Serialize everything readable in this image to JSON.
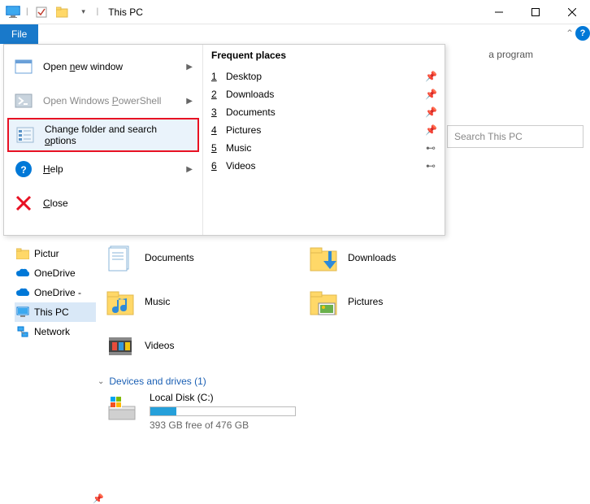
{
  "window": {
    "title": "This PC"
  },
  "tabs": {
    "file": "File"
  },
  "ribbon_peek": "a program",
  "file_menu": {
    "items": [
      {
        "prefix": "Open ",
        "u": "n",
        "rest": "ew window",
        "dim": false,
        "arrow": true,
        "highlight": false
      },
      {
        "prefix": "Open Windows ",
        "u": "P",
        "rest": "owerShell",
        "dim": true,
        "arrow": true,
        "highlight": false
      },
      {
        "prefix": "Change folder and search ",
        "u": "o",
        "rest": "ptions",
        "dim": false,
        "arrow": false,
        "highlight": true
      },
      {
        "prefix": "",
        "u": "H",
        "rest": "elp",
        "dim": false,
        "arrow": true,
        "highlight": false
      },
      {
        "prefix": "",
        "u": "C",
        "rest": "lose",
        "dim": false,
        "arrow": false,
        "highlight": false
      }
    ],
    "frequent_title": "Frequent places",
    "frequent": [
      {
        "n": "1",
        "name": "Desktop",
        "pin": "push"
      },
      {
        "n": "2",
        "name": "Downloads",
        "pin": "push"
      },
      {
        "n": "3",
        "name": "Documents",
        "pin": "push"
      },
      {
        "n": "4",
        "name": "Pictures",
        "pin": "push"
      },
      {
        "n": "5",
        "name": "Music",
        "pin": "tack"
      },
      {
        "n": "6",
        "name": "Videos",
        "pin": "tack"
      }
    ]
  },
  "search": {
    "placeholder": "Search This PC"
  },
  "nav": {
    "items": [
      {
        "label": "Pictur"
      },
      {
        "label": "OneDrive"
      },
      {
        "label": "OneDrive -"
      },
      {
        "label": "This PC"
      },
      {
        "label": "Network"
      }
    ]
  },
  "folders": {
    "row1": [
      {
        "label": "Documents"
      },
      {
        "label": "Downloads"
      }
    ],
    "row2": [
      {
        "label": "Music"
      },
      {
        "label": "Pictures"
      }
    ],
    "row3": [
      {
        "label": "Videos"
      }
    ]
  },
  "section": {
    "title": "Devices and drives (1)"
  },
  "drive": {
    "name": "Local Disk (C:)",
    "free": "393 GB free of 476 GB"
  }
}
